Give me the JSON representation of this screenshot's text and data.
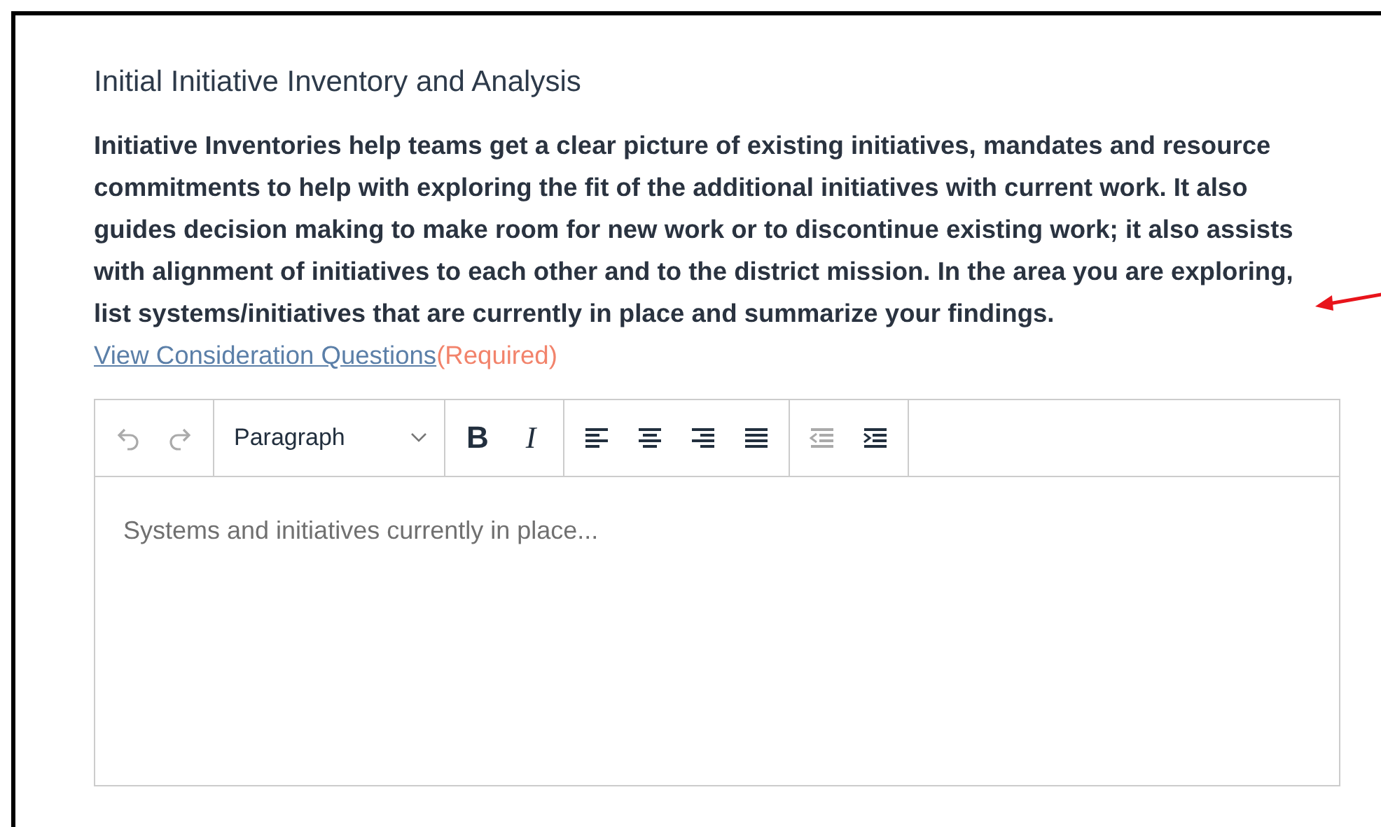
{
  "section": {
    "title": "Initial Initiative Inventory and Analysis",
    "description": "Initiative Inventories help teams get a clear picture of existing initiatives, mandates and resource commitments to help with exploring the fit of the additional initiatives with current work. It also guides decision making to make room for new work or to discontinue existing work; it also assists with alignment of initiatives to each other and to the district mission. In the area you are exploring, list systems/initiatives that are currently in place and summarize your findings.",
    "link": "View Consideration Questions",
    "required": "(Required)"
  },
  "editor": {
    "toolbar": [
      [
        {
          "kind": "undo",
          "disabled": true
        },
        {
          "kind": "redo",
          "disabled": true
        }
      ],
      [
        {
          "kind": "select",
          "label": "Paragraph",
          "disabled": false
        }
      ],
      [
        {
          "kind": "bold",
          "label": "B",
          "disabled": false
        },
        {
          "kind": "italic",
          "label": "I",
          "disabled": false
        }
      ],
      [
        {
          "kind": "align-left",
          "disabled": false
        },
        {
          "kind": "align-center",
          "disabled": false
        },
        {
          "kind": "align-right",
          "disabled": false
        },
        {
          "kind": "align-justify",
          "disabled": false
        }
      ],
      [
        {
          "kind": "outdent",
          "disabled": true
        },
        {
          "kind": "indent",
          "disabled": false
        }
      ]
    ],
    "placeholder": "Systems and initiatives currently in place..."
  }
}
